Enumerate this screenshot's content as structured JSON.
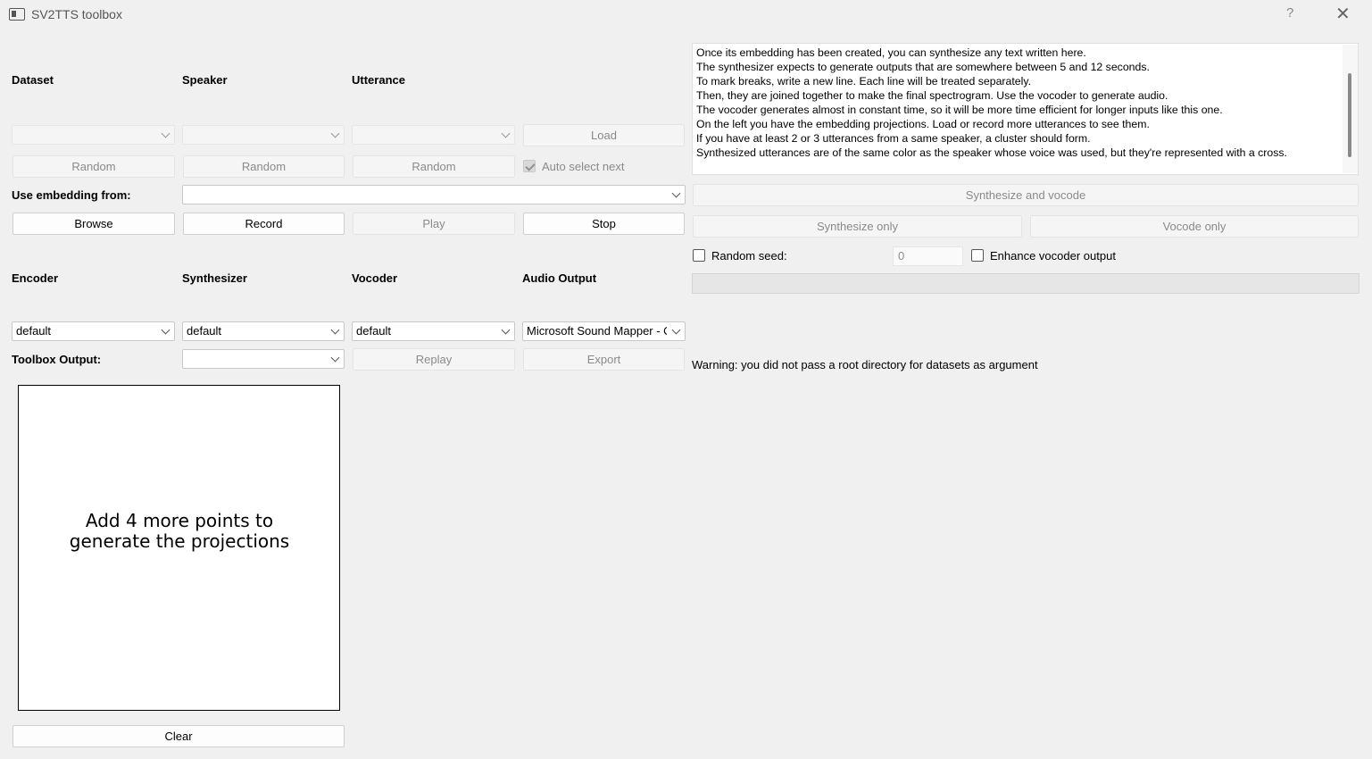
{
  "window": {
    "title": "SV2TTS toolbox",
    "help_glyph": "?",
    "close_glyph": "✕"
  },
  "dataset_section": {
    "dataset_label": "Dataset",
    "speaker_label": "Speaker",
    "utterance_label": "Utterance",
    "dataset_value": "",
    "speaker_value": "",
    "utterance_value": "",
    "load_button": "Load",
    "random_dataset_button": "Random",
    "random_speaker_button": "Random",
    "random_utterance_button": "Random",
    "auto_select_next_label": "Auto select next",
    "auto_select_next_checked": true,
    "use_embedding_label": "Use embedding from:",
    "use_embedding_value": "",
    "browse_button": "Browse",
    "record_button": "Record",
    "play_button": "Play",
    "stop_button": "Stop"
  },
  "models_section": {
    "encoder_label": "Encoder",
    "synthesizer_label": "Synthesizer",
    "vocoder_label": "Vocoder",
    "audio_output_label": "Audio Output",
    "encoder_value": "default",
    "synthesizer_value": "default",
    "vocoder_value": "default",
    "audio_output_value": "Microsoft Sound Mapper - Output",
    "toolbox_output_label": "Toolbox Output:",
    "toolbox_output_value": "",
    "replay_button": "Replay",
    "export_button": "Export"
  },
  "projections": {
    "message": "Add 4 more points to generate the projections",
    "clear_button": "Clear"
  },
  "text_input": {
    "lines": [
      "Once its embedding has been created, you can synthesize any text written here.",
      "The synthesizer expects to generate outputs that are somewhere between 5 and 12 seconds.",
      "To mark breaks, write a new line. Each line will be treated separately.",
      "Then, they are joined together to make the final spectrogram. Use the vocoder to generate audio.",
      "The vocoder generates almost in constant time, so it will be more time efficient for longer inputs like this one.",
      "On the left you have the embedding projections. Load or record more utterances to see them.",
      "If you have at least 2 or 3 utterances from a same speaker, a cluster should form.",
      "Synthesized utterances are of the same color as the speaker whose voice was used, but they're represented with a cross."
    ]
  },
  "synthesis": {
    "synthesize_and_vocode_button": "Synthesize and vocode",
    "synthesize_only_button": "Synthesize only",
    "vocode_only_button": "Vocode only",
    "random_seed_label": "Random seed:",
    "random_seed_checked": false,
    "seed_value": "0",
    "enhance_vocoder_label": "Enhance vocoder output",
    "enhance_vocoder_checked": false,
    "progress": 0,
    "warning_text": "Warning: you did not pass a root directory for datasets as argument"
  }
}
